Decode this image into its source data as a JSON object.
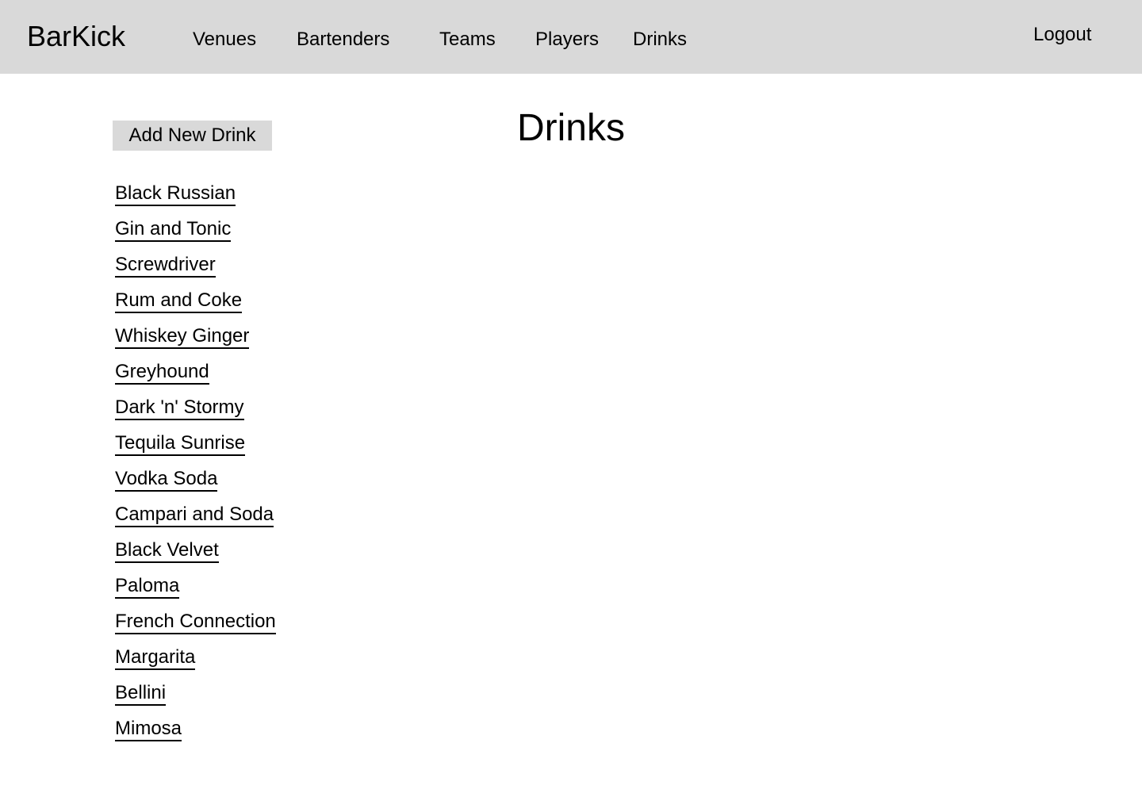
{
  "header": {
    "brand": "BarKick",
    "nav": [
      {
        "label": "Venues"
      },
      {
        "label": "Bartenders"
      },
      {
        "label": "Teams"
      },
      {
        "label": "Players"
      },
      {
        "label": "Drinks"
      }
    ],
    "logout_label": "Logout"
  },
  "main": {
    "title": "Drinks",
    "add_button_label": "Add New Drink",
    "drinks": [
      {
        "name": "Black Russian"
      },
      {
        "name": "Gin and Tonic"
      },
      {
        "name": "Screwdriver"
      },
      {
        "name": "Rum and Coke"
      },
      {
        "name": "Whiskey Ginger"
      },
      {
        "name": "Greyhound"
      },
      {
        "name": "Dark 'n' Stormy"
      },
      {
        "name": "Tequila Sunrise"
      },
      {
        "name": "Vodka Soda"
      },
      {
        "name": "Campari and Soda"
      },
      {
        "name": "Black Velvet"
      },
      {
        "name": "Paloma"
      },
      {
        "name": "French Connection"
      },
      {
        "name": "Margarita"
      },
      {
        "name": "Bellini"
      },
      {
        "name": "Mimosa"
      }
    ]
  },
  "colors": {
    "header_bg": "#d9d9d9",
    "button_bg": "#d9d9d9",
    "text": "#000000",
    "page_bg": "#ffffff"
  }
}
